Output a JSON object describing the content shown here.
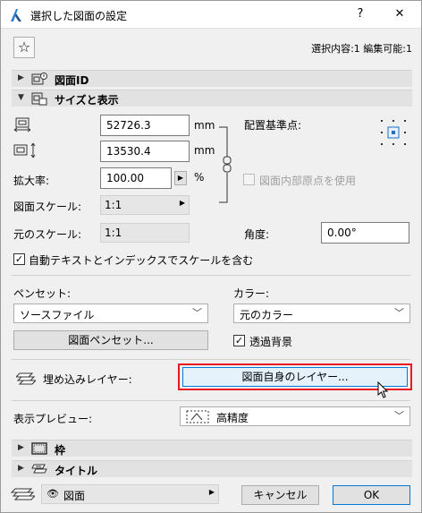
{
  "window": {
    "title": "選択した図面の設定",
    "help": "?",
    "close": "✕"
  },
  "header": {
    "selection_info": "選択内容:1 編集可能:1"
  },
  "sections": {
    "drawing_id": "図面ID",
    "size_display": "サイズと表示",
    "frame": "枠",
    "title": "タイトル"
  },
  "size": {
    "width_value": "52726.3",
    "height_value": "13530.4",
    "width_unit": "mm",
    "height_unit": "mm",
    "scale_label": "拡大率:",
    "scale_value": "100.00",
    "scale_unit": "%",
    "drawing_scale_label": "図面スケール:",
    "drawing_scale_value": "1:1",
    "original_scale_label": "元のスケール:",
    "original_scale_value": "1:1",
    "anchor_label": "配置基準点:",
    "use_origin_label": "図面内部原点を使用",
    "angle_label": "角度:",
    "angle_value": "0.00°",
    "auto_text_label": "自動テキストとインデックスでスケールを含む"
  },
  "pens": {
    "penset_label": "ペンセット:",
    "penset_value": "ソースファイル",
    "penset_button": "図面ペンセット...",
    "color_label": "カラー:",
    "color_value": "元のカラー",
    "transparent_label": "透過背景"
  },
  "layers": {
    "embedded_label": "埋め込みレイヤー:",
    "own_layer_button": "図面自身のレイヤー..."
  },
  "preview": {
    "label": "表示プレビュー:",
    "value": "高精度"
  },
  "footer": {
    "layer_value": "図面",
    "cancel": "キャンセル",
    "ok": "OK"
  },
  "colors": {
    "highlight_border": "#e8191f",
    "ok_border": "#0078d7",
    "primary_button_bg": "#e5f1fb",
    "section_bg": "#e2e2e2",
    "anchor_dot": "#1e70c2"
  },
  "icons": {
    "star": "☆",
    "check": "✓"
  }
}
